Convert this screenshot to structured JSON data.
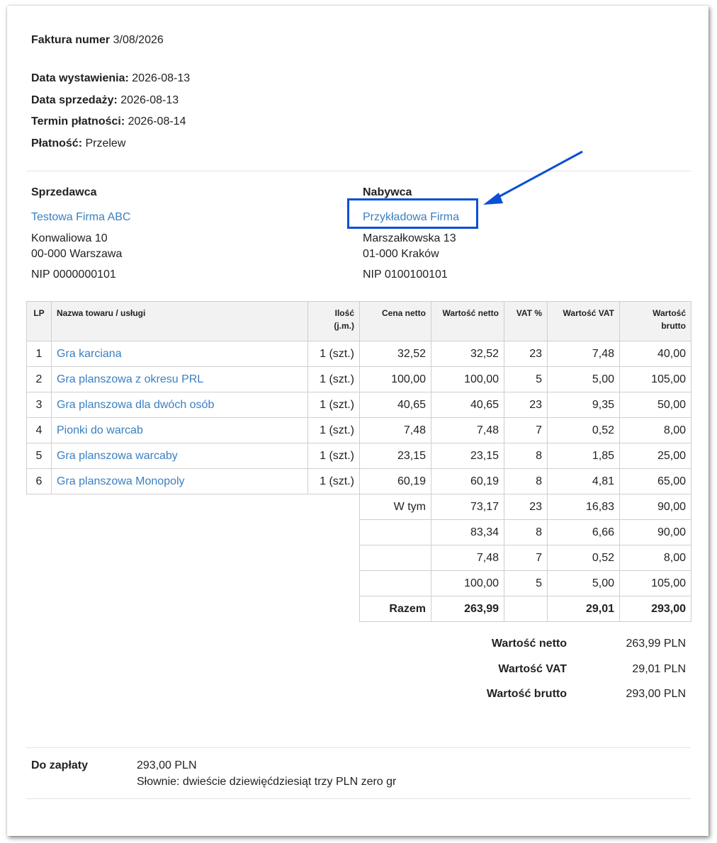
{
  "invoice": {
    "number_label": "Faktura numer",
    "number": "3/08/2026",
    "issue_label": "Data wystawienia:",
    "issue_date": "2026-08-13",
    "sale_label": "Data sprzedaży:",
    "sale_date": "2026-08-13",
    "due_label": "Termin płatności:",
    "due_date": "2026-08-14",
    "payment_label": "Płatność:",
    "payment_method": "Przelew"
  },
  "seller": {
    "heading": "Sprzedawca",
    "name": "Testowa Firma ABC",
    "street": "Konwaliowa 10",
    "city": "00-000 Warszawa",
    "nip": "NIP 0000000101"
  },
  "buyer": {
    "heading": "Nabywca",
    "name": "Przykładowa Firma",
    "street": "Marszałkowska 13",
    "city": "01-000 Kraków",
    "nip": "NIP 0100100101"
  },
  "table": {
    "headers": {
      "lp": "LP",
      "name": "Nazwa towaru / usługi",
      "qty1": "Ilość",
      "qty2": "(j.m.)",
      "unit_net": "Cena netto",
      "net": "Wartość netto",
      "vat_pct": "VAT %",
      "vat": "Wartość VAT",
      "gross1": "Wartość",
      "gross2": "brutto"
    },
    "rows": [
      {
        "lp": "1",
        "name": "Gra karciana",
        "qty": "1 (szt.)",
        "unit_net": "32,52",
        "net": "32,52",
        "vat_pct": "23",
        "vat": "7,48",
        "gross": "40,00"
      },
      {
        "lp": "2",
        "name": "Gra planszowa z okresu PRL",
        "qty": "1 (szt.)",
        "unit_net": "100,00",
        "net": "100,00",
        "vat_pct": "5",
        "vat": "5,00",
        "gross": "105,00"
      },
      {
        "lp": "3",
        "name": "Gra planszowa dla dwóch osób",
        "qty": "1 (szt.)",
        "unit_net": "40,65",
        "net": "40,65",
        "vat_pct": "23",
        "vat": "9,35",
        "gross": "50,00"
      },
      {
        "lp": "4",
        "name": "Pionki do warcab",
        "qty": "1 (szt.)",
        "unit_net": "7,48",
        "net": "7,48",
        "vat_pct": "7",
        "vat": "0,52",
        "gross": "8,00"
      },
      {
        "lp": "5",
        "name": "Gra planszowa warcaby",
        "qty": "1 (szt.)",
        "unit_net": "23,15",
        "net": "23,15",
        "vat_pct": "8",
        "vat": "1,85",
        "gross": "25,00"
      },
      {
        "lp": "6",
        "name": "Gra planszowa Monopoly",
        "qty": "1 (szt.)",
        "unit_net": "60,19",
        "net": "60,19",
        "vat_pct": "8",
        "vat": "4,81",
        "gross": "65,00"
      }
    ],
    "breakdown_label": "W tym",
    "breakdown": [
      {
        "net": "73,17",
        "vat_pct": "23",
        "vat": "16,83",
        "gross": "90,00"
      },
      {
        "net": "83,34",
        "vat_pct": "8",
        "vat": "6,66",
        "gross": "90,00"
      },
      {
        "net": "7,48",
        "vat_pct": "7",
        "vat": "0,52",
        "gross": "8,00"
      },
      {
        "net": "100,00",
        "vat_pct": "5",
        "vat": "5,00",
        "gross": "105,00"
      }
    ],
    "total_label": "Razem",
    "total": {
      "net": "263,99",
      "vat": "29,01",
      "gross": "293,00"
    }
  },
  "totals": {
    "net_label": "Wartość netto",
    "net": "263,99 PLN",
    "vat_label": "Wartość VAT",
    "vat": "29,01 PLN",
    "gross_label": "Wartość brutto",
    "gross": "293,00 PLN"
  },
  "payment_due": {
    "label": "Do zapłaty",
    "amount": "293,00 PLN",
    "in_words": "Słownie: dwieście dziewięćdziesiąt trzy PLN zero gr"
  },
  "annotation": {
    "color": "#0a4fd6"
  }
}
